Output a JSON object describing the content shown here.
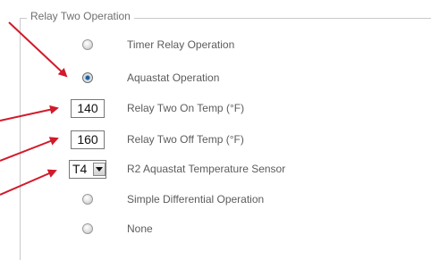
{
  "group": {
    "title": "Relay Two Operation"
  },
  "rows": [
    {
      "type": "radio",
      "label": "Timer Relay Operation",
      "checked": false
    },
    {
      "type": "radio",
      "label": "Aquastat Operation",
      "checked": true
    },
    {
      "type": "number",
      "label": "Relay Two On Temp (°F)",
      "value": "140"
    },
    {
      "type": "number",
      "label": "Relay Two Off Temp (°F)",
      "value": "160"
    },
    {
      "type": "select",
      "label": "R2 Aquastat Temperature Sensor",
      "value": "T4"
    },
    {
      "type": "radio",
      "label": "Simple Differential Operation",
      "checked": false
    },
    {
      "type": "radio",
      "label": "None",
      "checked": false
    }
  ],
  "colors": {
    "arrow": "#d11a2a",
    "selected_radio": "#1c5e9c"
  },
  "icons": {
    "dropdown": "chevron-down-icon"
  }
}
